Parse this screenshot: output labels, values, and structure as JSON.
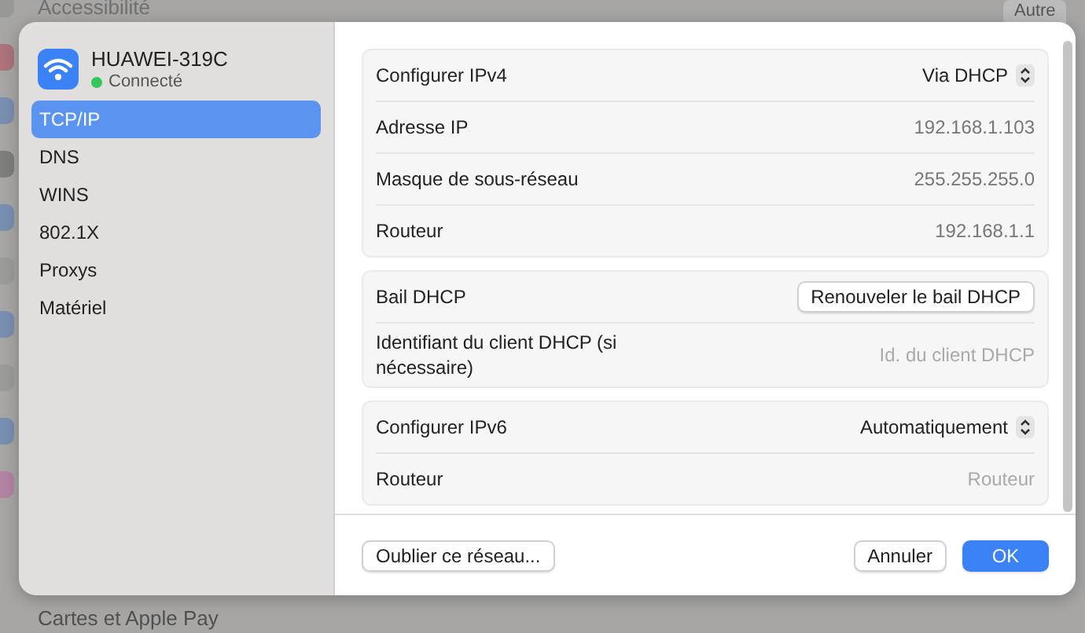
{
  "background": {
    "top_item": "Accessibilité",
    "bottom_item": "Cartes et Apple Pay",
    "button": "Autre"
  },
  "network": {
    "name": "HUAWEI-319C",
    "status": "Connecté",
    "connected": true
  },
  "sidebar": {
    "items": [
      {
        "label": "TCP/IP",
        "selected": true
      },
      {
        "label": "DNS",
        "selected": false
      },
      {
        "label": "WINS",
        "selected": false
      },
      {
        "label": "802.1X",
        "selected": false
      },
      {
        "label": "Proxys",
        "selected": false
      },
      {
        "label": "Matériel",
        "selected": false
      }
    ]
  },
  "groups": [
    [
      {
        "kind": "popup",
        "label": "Configurer IPv4",
        "value": "Via DHCP"
      },
      {
        "kind": "value",
        "label": "Adresse IP",
        "value": "192.168.1.103"
      },
      {
        "kind": "value",
        "label": "Masque de sous-réseau",
        "value": "255.255.255.0"
      },
      {
        "kind": "value",
        "label": "Routeur",
        "value": "192.168.1.1"
      }
    ],
    [
      {
        "kind": "button",
        "label": "Bail DHCP",
        "value": "Renouveler le bail DHCP"
      },
      {
        "kind": "field",
        "label": "Identifiant du client DHCP (si nécessaire)",
        "placeholder": "Id. du client DHCP"
      }
    ],
    [
      {
        "kind": "popup",
        "label": "Configurer IPv6",
        "value": "Automatiquement"
      },
      {
        "kind": "field",
        "label": "Routeur",
        "placeholder": "Routeur"
      }
    ]
  ],
  "footer": {
    "left_button": "Oublier ce réseau...",
    "buttons": [
      {
        "label": "Annuler",
        "primary": false
      },
      {
        "label": "OK",
        "primary": true
      }
    ]
  }
}
